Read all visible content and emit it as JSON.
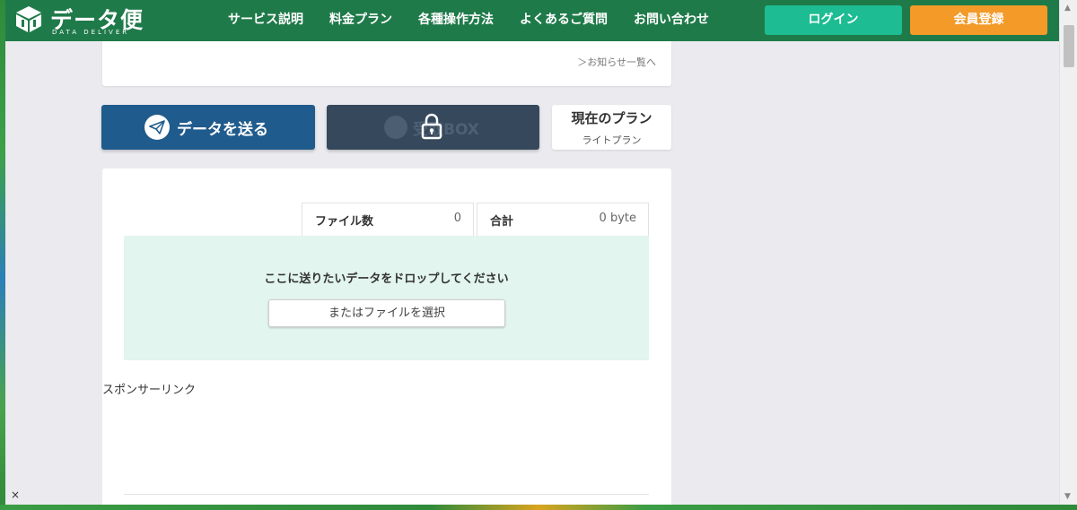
{
  "header": {
    "logo_text": "データ便",
    "logo_sub": "DATA DELIVER",
    "nav": [
      "サービス説明",
      "料金プラン",
      "各種操作方法",
      "よくあるご質問",
      "お問い合わせ"
    ],
    "login_label": "ログイン",
    "register_label": "会員登録"
  },
  "news": {
    "link_label": "＞お知らせ一覧へ"
  },
  "actions": {
    "send_label": "データを送る",
    "box_label": "受取BOX",
    "plan_title": "現在のプラン",
    "plan_name": "ライトプラン"
  },
  "upload": {
    "file_count_label": "ファイル数",
    "file_count_value": "0",
    "total_label": "合計",
    "total_value": "0 byte",
    "drop_text": "ここに送りたいデータをドロップしてください",
    "select_label": "またはファイルを選択"
  },
  "sponsor_label": "スポンサーリンク",
  "overlay": {
    "close_symbol": "×"
  },
  "colors": {
    "header_bg": "#1f7a4a",
    "login_bg": "#1dbc92",
    "register_bg": "#f39a28",
    "send_bg": "#1f5b8c",
    "box_bg": "#36485c",
    "dropzone_bg": "#e2f5ee"
  }
}
